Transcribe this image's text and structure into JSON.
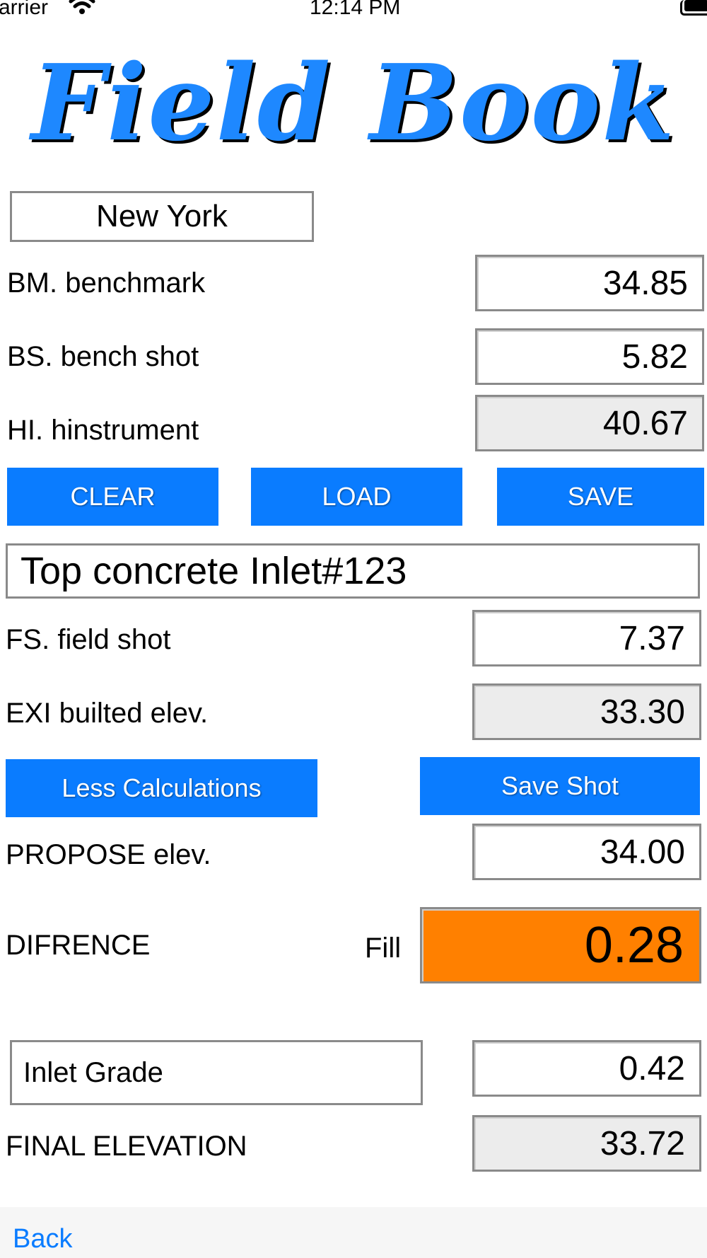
{
  "status_bar": {
    "carrier": "arrier",
    "time": "12:14 PM"
  },
  "title": "Field Book",
  "city": "New York",
  "rows": {
    "bm": {
      "label": "BM. benchmark",
      "value": "34.85"
    },
    "bs": {
      "label": "BS. bench shot",
      "value": "5.82"
    },
    "hi": {
      "label": "HI. hinstrument",
      "value": "40.67"
    }
  },
  "buttons": {
    "clear": "CLEAR",
    "load": "LOAD",
    "save": "SAVE",
    "less_calc": "Less Calculations",
    "save_shot": "Save Shot"
  },
  "description": "Top concrete Inlet#123",
  "fs": {
    "label": "FS. field shot",
    "value": "7.37"
  },
  "exi": {
    "label": "EXI builted elev.",
    "value": "33.30"
  },
  "propose": {
    "label": "PROPOSE elev.",
    "value": "34.00"
  },
  "difference": {
    "label": "DIFRENCE",
    "type": "Fill",
    "value": "0.28"
  },
  "inlet": {
    "label": "Inlet Grade",
    "value": "0.42"
  },
  "final": {
    "label": "FINAL ELEVATION",
    "value": "33.72"
  },
  "nav": {
    "back": "Back"
  },
  "colors": {
    "accent": "#0a7cff",
    "title": "#1e88ff",
    "fill": "#ff8000",
    "readonly": "#ececec"
  }
}
